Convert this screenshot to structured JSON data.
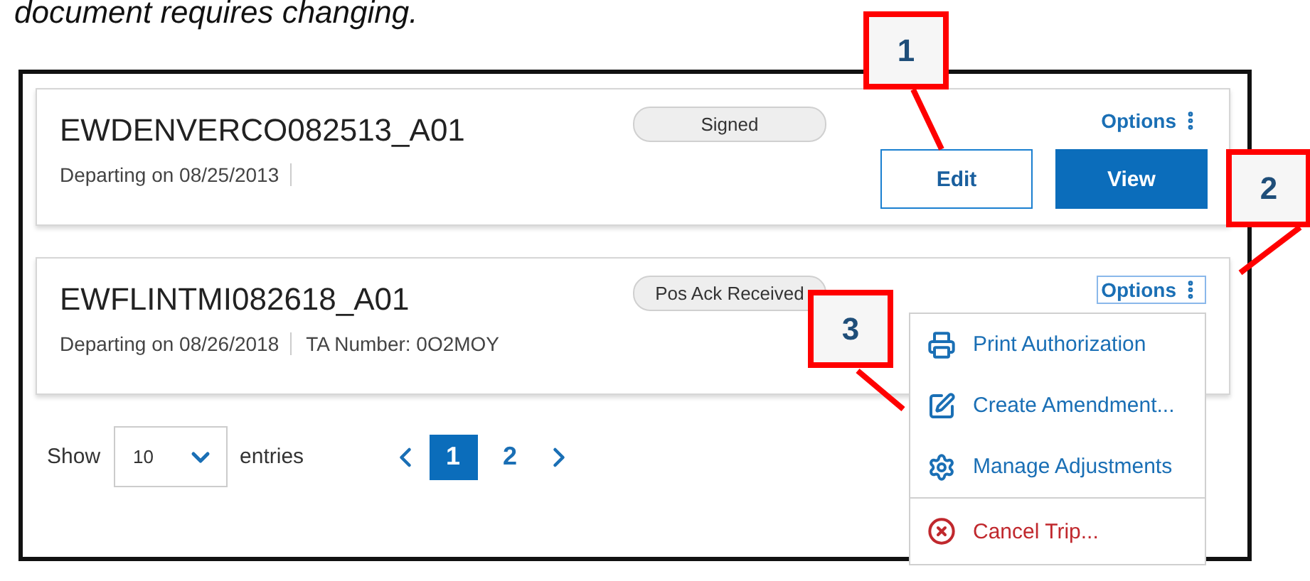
{
  "caption": "document requires changing.",
  "trips": [
    {
      "title": "EWDENVERCO082513_A01",
      "status": "Signed",
      "details": [
        "Departing on 08/25/2013"
      ],
      "options": {
        "label": "Options",
        "focused": false
      },
      "buttons": [
        {
          "label": "Edit",
          "kind": "outline"
        },
        {
          "label": "View",
          "kind": "primary"
        }
      ]
    },
    {
      "title": "EWFLINTMI082618_A01",
      "status": "Pos Ack Received",
      "details": [
        "Departing on 08/26/2018",
        "TA Number: 0O2MOY"
      ],
      "options": {
        "label": "Options",
        "focused": true
      },
      "menu": [
        {
          "label": "Print Authorization",
          "kind": "action"
        },
        {
          "label": "Create Amendment...",
          "kind": "action"
        },
        {
          "label": "Manage Adjustments",
          "kind": "action"
        },
        {
          "label": "Cancel Trip...",
          "kind": "danger"
        }
      ]
    }
  ],
  "pager": {
    "show_label": "Show",
    "page_size": "10",
    "entries_label": "entries",
    "pages": [
      {
        "label": "1",
        "selected": true
      },
      {
        "label": "2",
        "selected": false
      }
    ]
  },
  "callouts": [
    "1",
    "2",
    "3"
  ]
}
